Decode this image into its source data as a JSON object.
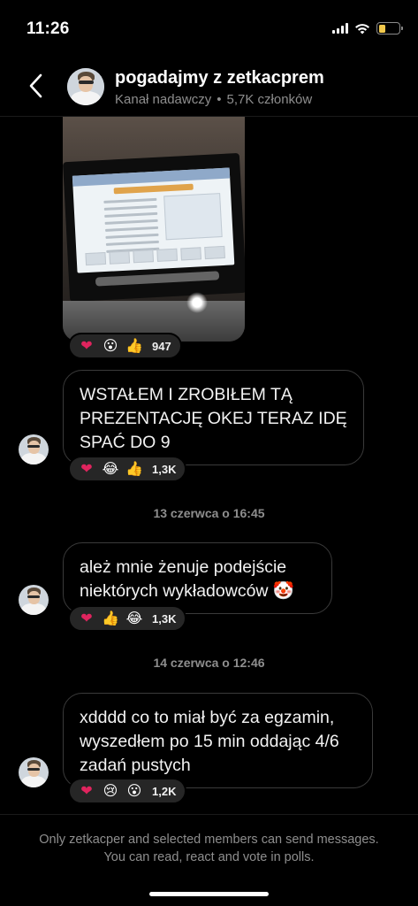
{
  "status_bar": {
    "time": "11:26",
    "battery_level": 0.35,
    "battery_color": "#f2c94c"
  },
  "header": {
    "title": "pogadajmy z zetkacprem",
    "subtitle_kind": "Kanał nadawczy",
    "separator": "•",
    "member_count": "5,7K członków"
  },
  "messages": [
    {
      "type": "image",
      "reactions": {
        "emojis": [
          "heart",
          "astonished",
          "thumbs-up"
        ],
        "count": "947"
      }
    },
    {
      "type": "text",
      "text": "WSTAŁEM I ZROBIŁEM TĄ PREZENTACJĘ OKEJ TERAZ IDĘ SPAĆ DO 9",
      "reactions": {
        "emojis": [
          "heart",
          "joy",
          "thumbs-up"
        ],
        "count": "1,3K"
      }
    },
    {
      "type": "date",
      "text": "13 czerwca o 16:45"
    },
    {
      "type": "text",
      "text": "ależ mnie żenuje podejście niektórych wykładowców 🤡",
      "reactions": {
        "emojis": [
          "heart",
          "thumbs-up",
          "joy"
        ],
        "count": "1,3K"
      }
    },
    {
      "type": "date",
      "text": "14 czerwca o 12:46"
    },
    {
      "type": "text",
      "text": "xdddd co to miał być za egzamin, wyszedłem po 15 min oddając 4/6 zadań pustych",
      "reactions": {
        "emojis": [
          "heart",
          "cry",
          "astonished"
        ],
        "count": "1,2K"
      }
    }
  ],
  "footer": {
    "line1": "Only zetkacper and selected members can send messages.",
    "line2": "You can read, react and vote in polls."
  },
  "colors": {
    "background": "#000000",
    "muted": "#8e8e8e",
    "reaction_pill": "#262626",
    "bubble_border": "#3a3a3a"
  }
}
